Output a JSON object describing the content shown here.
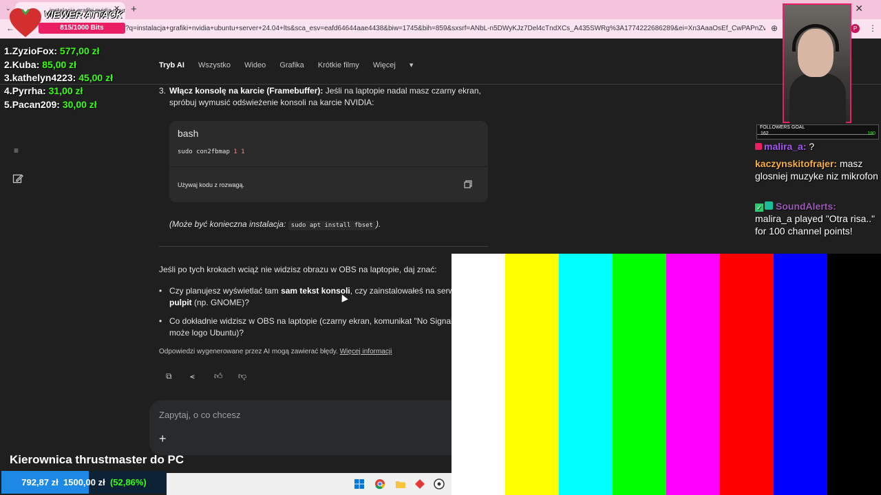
{
  "browser": {
    "tab_title": "instalacja grafiki nvidia ubuntu",
    "url": "?q=instalacja+grafiki+nvidia+ubuntu+server+24.04+lts&sca_esv=eafd64644aae4438&biw=1745&bih=859&sxsrf=ANbL-n5DWyKJz7Del4cTndXCs_A435SWRg%3A1774222686289&ei=Xn3AaaOsEf_CwPAPnZvY8Qg&ved=2ah...",
    "profile_initial": "P"
  },
  "nav": {
    "tabs": [
      "Tryb AI",
      "Wszystko",
      "Wideo",
      "Grafika",
      "Krótkie filmy",
      "Więcej"
    ]
  },
  "content": {
    "step_number": "3.",
    "step_title": "Włącz konsolę na karcie (Framebuffer):",
    "step_text": " Jeśli na laptopie nadal masz czarny ekran, spróbuj wymusić odświeżenie konsoli na karcie NVIDIA:",
    "code": {
      "lang": "bash",
      "cmd": "sudo con2fbmap ",
      "args": "1 1",
      "note": "Używaj kodu z rozwagą."
    },
    "note_prefix": "(Może być konieczna instalacja: ",
    "note_code": "sudo apt install fbset",
    "note_suffix": ").",
    "para": "Jeśli po tych krokach wciąż nie widzisz obrazu w OBS na laptopie, daj znać:",
    "bullet1_a": "Czy planujesz wyświetlać tam ",
    "bullet1_b": "sam tekst konsoli",
    "bullet1_c": ", czy zainstalowałeś na serw",
    "bullet1_d": "pulpit",
    "bullet1_e": " (np. GNOME)?",
    "bullet2": "Co dokładnie widzisz w OBS na laptopie (czarny ekran, komunikat \"No Signal\"",
    "bullet2_b": "może logo Ubuntu)?",
    "disclaimer": "Odpowiedzi wygenerowane przez AI mogą zawierać błędy. ",
    "disclaimer_link": "Więcej informacji",
    "ask_placeholder": "Zapytaj, o co chcesz"
  },
  "overlay": {
    "viewer_attack": "VIEWER ATTACK",
    "bits": "815/1000 Bits",
    "leaderboard": [
      {
        "rank": "1.",
        "name": "ZyzioFox:",
        "amount": "577,00 zł"
      },
      {
        "rank": "2.",
        "name": "Kuba:",
        "amount": "85,00 zł"
      },
      {
        "rank": "3.",
        "name": "kathelyn4223:",
        "amount": "45,00 zł"
      },
      {
        "rank": "4.",
        "name": "Pyrrha:",
        "amount": "31,00 zł"
      },
      {
        "rank": "5.",
        "name": "Pacan209:",
        "amount": "30,00 zł"
      }
    ],
    "followers_goal": "FOLLOWERS GOAL",
    "followers_current": "162",
    "followers_target": "180",
    "chat": [
      {
        "user": "malira_a:",
        "text": " ?"
      },
      {
        "user": "kaczynskitofrajer:",
        "text": " masz glosniej muzyke niz mikrofon"
      },
      {
        "user": "SoundAlerts:",
        "text": "malira_a played \"Otra risa..\" for 100 channel points!"
      }
    ],
    "goal_title": "Kierownica thrustmaster do PC",
    "goal_current": "792,87 zł",
    "goal_target": "1500,00 zł",
    "goal_pct": "(52,86%)",
    "goal_fraction": 0.5286
  },
  "colors": {
    "bars": [
      "#ffffff",
      "#ffff00",
      "#00ffff",
      "#00ff00",
      "#ff00ff",
      "#ff0000",
      "#0000ff",
      "#000000"
    ],
    "accent": "#e91e63",
    "money": "#39ff14"
  }
}
